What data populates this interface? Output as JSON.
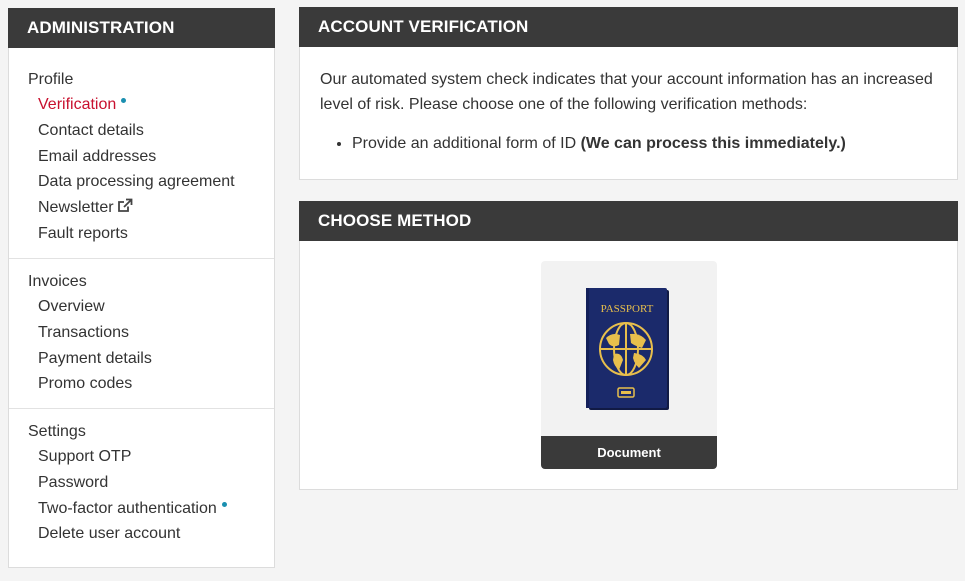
{
  "sidebar": {
    "title": "ADMINISTRATION",
    "groups": [
      {
        "title": "Profile",
        "items": [
          {
            "label": "Verification",
            "active": true,
            "dot": true
          },
          {
            "label": "Contact details"
          },
          {
            "label": "Email addresses"
          },
          {
            "label": "Data processing agreement"
          },
          {
            "label": "Newsletter",
            "icon": "external-link-icon"
          },
          {
            "label": "Fault reports"
          }
        ]
      },
      {
        "title": "Invoices",
        "items": [
          {
            "label": "Overview"
          },
          {
            "label": "Transactions"
          },
          {
            "label": "Payment details"
          },
          {
            "label": "Promo codes"
          }
        ]
      },
      {
        "title": "Settings",
        "items": [
          {
            "label": "Support OTP"
          },
          {
            "label": "Password"
          },
          {
            "label": "Two-factor authentication",
            "dot": true
          },
          {
            "label": "Delete user account"
          }
        ]
      }
    ]
  },
  "verification": {
    "title": "ACCOUNT VERIFICATION",
    "message": "Our automated system check indicates that your account information has an increased level of risk. Please choose one of the following verification methods:",
    "options": [
      {
        "text": "Provide an additional form of ID ",
        "emphasis": "(We can process this immediately.)"
      }
    ]
  },
  "choose_method": {
    "title": "CHOOSE METHOD",
    "methods": [
      {
        "label": "Document",
        "image_text": "PASSPORT",
        "icon": "passport-icon"
      }
    ]
  },
  "colors": {
    "header_bg": "#3a3a3a",
    "active": "#c8102e",
    "dot": "#1a8fb0",
    "passport_blue": "#1b2a6b",
    "passport_gold": "#e8bf4c"
  }
}
